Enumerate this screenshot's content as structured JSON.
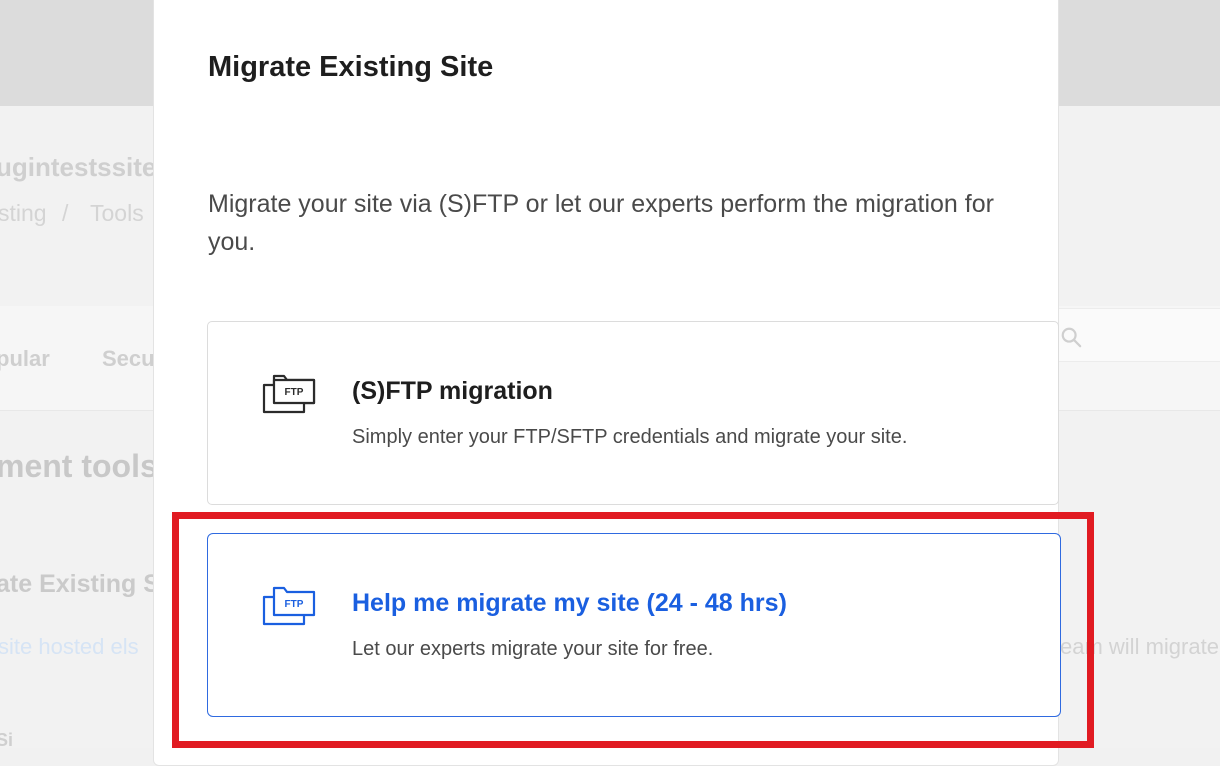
{
  "background": {
    "site_name": "ugintestssite",
    "breadcrumb": [
      "sting",
      "/",
      "Tools"
    ],
    "tabs": [
      "pular",
      "Secu"
    ],
    "section_heading": "ment tools",
    "card_title": "ate Existing S",
    "card_desc": "site hosted els",
    "right_desc": "eam will migrate",
    "bottom_label": "Si"
  },
  "modal": {
    "title": "Migrate Existing Site",
    "description": "Migrate your site via (S)FTP or let our experts perform the migration for you.",
    "options": [
      {
        "icon": "ftp-folder-icon",
        "icon_label": "FTP",
        "title": "(S)FTP migration",
        "description": "Simply enter your FTP/SFTP credentials and migrate your site."
      },
      {
        "icon": "ftp-folder-icon",
        "icon_label": "FTP",
        "title": "Help me migrate my site (24 - 48 hrs)",
        "description": "Let our experts migrate your site for free."
      }
    ]
  },
  "colors": {
    "accent": "#1a5fe0",
    "highlight": "#e11b22",
    "text": "#1e1e1e",
    "muted": "#4a4a4a"
  }
}
